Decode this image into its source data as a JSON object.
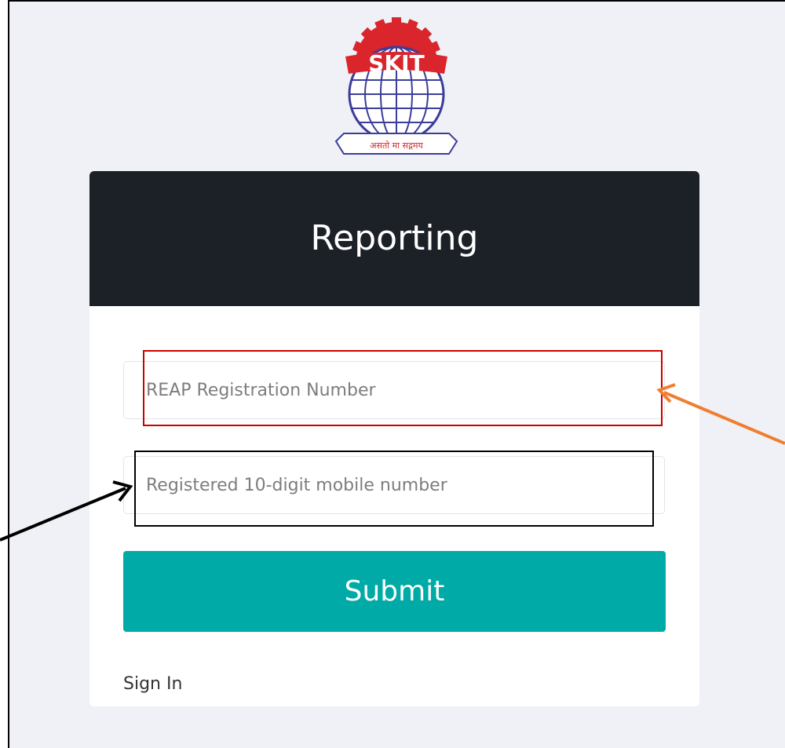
{
  "logo": {
    "brand_text": "SKIT",
    "motto": "असतो मा सद्गमय",
    "icon": "skit-emblem-icon",
    "colors": {
      "red": "#d9252b",
      "blue": "#3b3d9a"
    }
  },
  "card": {
    "title": "Reporting"
  },
  "form": {
    "reap_field": {
      "placeholder": "REAP Registration Number",
      "value": ""
    },
    "mobile_field": {
      "placeholder": "Registered 10-digit mobile number",
      "value": ""
    },
    "submit_label": "Submit",
    "signin_label": "Sign In"
  },
  "colors": {
    "header_bg": "#1b2127",
    "submit_bg": "#00aaa6",
    "page_bg": "#f0f1f6",
    "annotation_red": "#cc0000",
    "annotation_orange": "#f07e30",
    "annotation_black": "#000000"
  },
  "annotations": [
    {
      "name": "red-highlight-box",
      "color": "red"
    },
    {
      "name": "black-highlight-box",
      "color": "black"
    },
    {
      "name": "orange-arrow",
      "color": "orange"
    },
    {
      "name": "black-arrow",
      "color": "black"
    }
  ]
}
